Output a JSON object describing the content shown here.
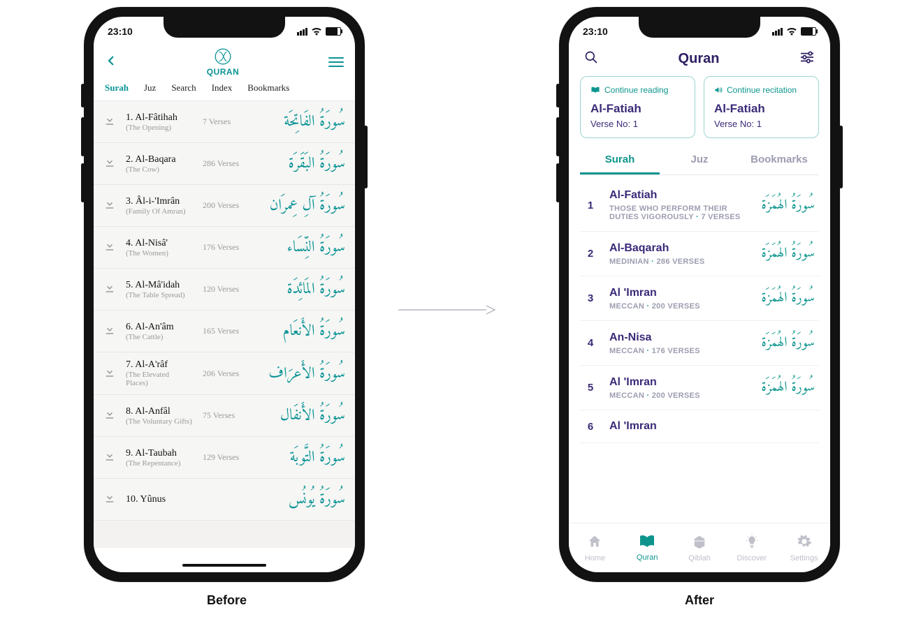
{
  "labels": {
    "before": "Before",
    "after": "After"
  },
  "before": {
    "status_time": "23:10",
    "brand": "QURAN",
    "tabs": [
      "Surah",
      "Juz",
      "Search",
      "Index",
      "Bookmarks"
    ],
    "active_tab_index": 0,
    "surahs": [
      {
        "num": "1.",
        "name": "Al-Fâtihah",
        "sub": "(The Opening)",
        "verses": "7 Verses",
        "arabic": "سُورَةُ الفَاتِحَة"
      },
      {
        "num": "2.",
        "name": "Al-Baqara",
        "sub": "(The Cow)",
        "verses": "286 Verses",
        "arabic": "سُورَةُ البَقَرَة"
      },
      {
        "num": "3.",
        "name": "Âl-i-'Imrân",
        "sub": "(Family Of Amran)",
        "verses": "200 Verses",
        "arabic": "سُورَةُ آلِ عِمرَان"
      },
      {
        "num": "4.",
        "name": "Al-Nisâ'",
        "sub": "(The Women)",
        "verses": "176 Verses",
        "arabic": "سُورَةُ النِّسَاء"
      },
      {
        "num": "5.",
        "name": "Al-Mâ'idah",
        "sub": "(The Table Spread)",
        "verses": "120 Verses",
        "arabic": "سُورَةُ المَائِدَة"
      },
      {
        "num": "6.",
        "name": "Al-An'âm",
        "sub": "(The Cattle)",
        "verses": "165 Verses",
        "arabic": "سُورَةُ الأَنعَام"
      },
      {
        "num": "7.",
        "name": "Al-A'râf",
        "sub": "(The Elevated Places)",
        "verses": "206 Verses",
        "arabic": "سُورَةُ الأَعرَاف"
      },
      {
        "num": "8.",
        "name": "Al-Anfâl",
        "sub": "(The Voluntary Gifts)",
        "verses": "75 Verses",
        "arabic": "سُورَةُ الأَنفَال"
      },
      {
        "num": "9.",
        "name": "Al-Taubah",
        "sub": "(The Repentance)",
        "verses": "129 Verses",
        "arabic": "سُورَةُ التَّوبَة"
      },
      {
        "num": "10.",
        "name": "Yûnus",
        "sub": "",
        "verses": "",
        "arabic": "سُورَةُ يُونُس"
      }
    ]
  },
  "after": {
    "status_time": "23:10",
    "title": "Quran",
    "cards": {
      "reading": {
        "label": "Continue reading",
        "surah": "Al-Fatiah",
        "verse": "Verse No: 1"
      },
      "recitation": {
        "label": "Continue recitation",
        "surah": "Al-Fatiah",
        "verse": "Verse No: 1"
      }
    },
    "tabs": [
      "Surah",
      "Juz",
      "Bookmarks"
    ],
    "active_tab_index": 0,
    "surahs": [
      {
        "idx": "1",
        "name": "Al-Fatiah",
        "meta": "THOSE WHO PERFORM THEIR DUTIES VIGOROUSLY",
        "verses": "7 VERSES",
        "arabic": "سُورَةُ الهُمَزَة"
      },
      {
        "idx": "2",
        "name": "Al-Baqarah",
        "meta": "MEDINIAN",
        "verses": "286 VERSES",
        "arabic": "سُورَةُ الهُمَزَة"
      },
      {
        "idx": "3",
        "name": "Al 'Imran",
        "meta": "MECCAN",
        "verses": "200 VERSES",
        "arabic": "سُورَةُ الهُمَزَة"
      },
      {
        "idx": "4",
        "name": "An-Nisa",
        "meta": "MECCAN",
        "verses": "176 VERSES",
        "arabic": "سُورَةُ الهُمَزَة"
      },
      {
        "idx": "5",
        "name": "Al 'Imran",
        "meta": "MECCAN",
        "verses": "200 VERSES",
        "arabic": "سُورَةُ الهُمَزَة"
      },
      {
        "idx": "6",
        "name": "Al 'Imran",
        "meta": "",
        "verses": "",
        "arabic": ""
      }
    ],
    "nav": [
      {
        "label": "Home",
        "icon": "home-icon"
      },
      {
        "label": "Quran",
        "icon": "book-icon"
      },
      {
        "label": "Qiblah",
        "icon": "kaaba-icon"
      },
      {
        "label": "Discover",
        "icon": "lightbulb-icon"
      },
      {
        "label": "Settings",
        "icon": "gear-icon"
      }
    ],
    "nav_active_index": 1
  }
}
